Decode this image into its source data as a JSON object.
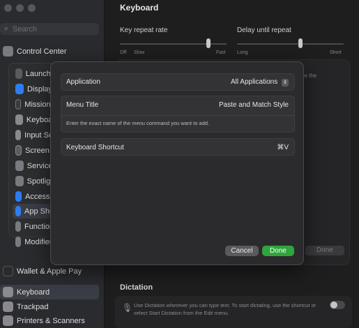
{
  "window": {
    "title": "Keyboard"
  },
  "sidebar": {
    "search_placeholder": "Search",
    "items": [
      {
        "label": "Control Center",
        "color": "#7a7b80"
      },
      {
        "label": "Launchpad",
        "color": "#5a5a5f"
      },
      {
        "label": "Displays",
        "color": "#2e7df0"
      },
      {
        "label": "Mission Control",
        "color": "#3b3b3f"
      },
      {
        "label": "Keyboard",
        "color": "#8a8a8e"
      },
      {
        "label": "Input Sources",
        "color": "#8a8a8e"
      },
      {
        "label": "Screen Saver",
        "color": "#5c5c60"
      },
      {
        "label": "Services",
        "color": "#7a7b80"
      },
      {
        "label": "Spotlight",
        "color": "#7a7b80"
      },
      {
        "label": "Accessibility",
        "color": "#2e7df0"
      },
      {
        "label": "App Shortcuts",
        "color": "#2e7df0"
      },
      {
        "label": "Function Keys",
        "color": "#7a7b80"
      },
      {
        "label": "Modifier Keys",
        "color": "#7a7b80"
      },
      {
        "label": "Wallet & Apple Pay",
        "color": "#2b2b2d"
      },
      {
        "label": "Keyboard",
        "color": "#8a8a8e"
      },
      {
        "label": "Trackpad",
        "color": "#8a8a8e"
      },
      {
        "label": "Printers & Scanners",
        "color": "#8a8a8e"
      }
    ]
  },
  "main": {
    "title": "Keyboard",
    "key_repeat": {
      "label": "Key repeat rate",
      "ticks": [
        "Off",
        "Slow",
        "Fast"
      ]
    },
    "delay_repeat": {
      "label": "Delay until repeat",
      "ticks": [
        "Long",
        "Short"
      ]
    },
    "bg_text": "pe the",
    "bg_done": "Done",
    "dictation": {
      "title": "Dictation",
      "text": "Use Dictation wherever you can type text. To start dictating, use the shortcut or select Start Dictation from the Edit menu."
    }
  },
  "dialog": {
    "application": {
      "label": "Application",
      "value": "All Applications"
    },
    "menu_title": {
      "label": "Menu Title",
      "value": "Paste and Match Style",
      "hint": "Enter the exact name of the menu command you want to add."
    },
    "shortcut": {
      "label": "Keyboard Shortcut",
      "value": "⌘V"
    },
    "cancel_label": "Cancel",
    "done_label": "Done"
  }
}
